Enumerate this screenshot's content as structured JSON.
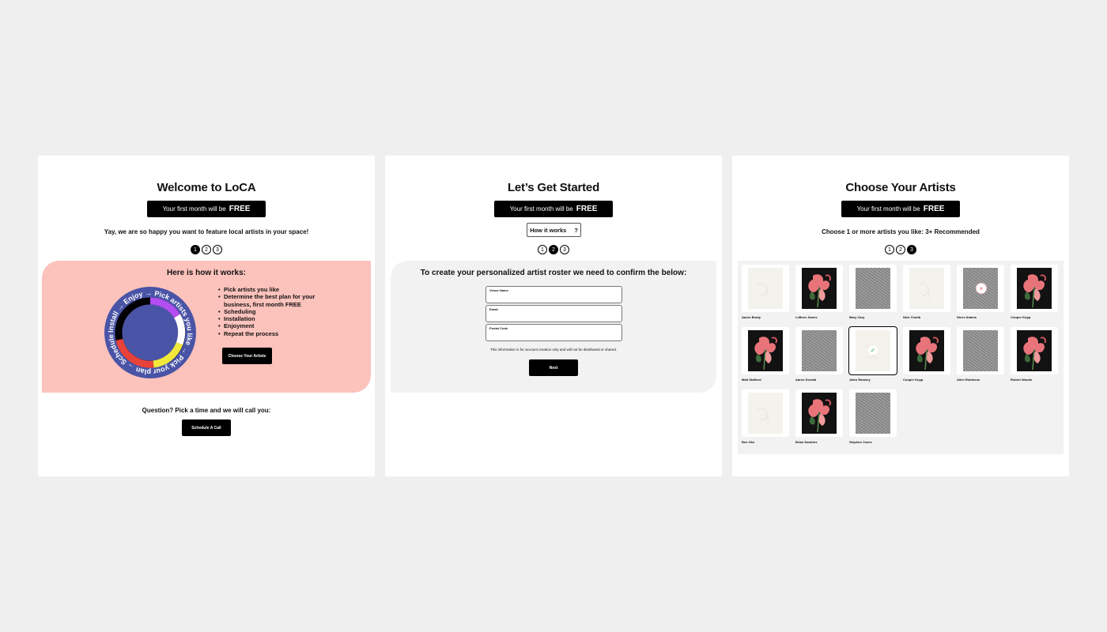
{
  "panels": {
    "welcome": {
      "title": "Welcome to LoCA",
      "badge_text": "Your first month will be",
      "badge_strong": "FREE",
      "subtitle": "Yay, we are so happy you want to feature local artists in your space!",
      "steps": [
        "1",
        "2",
        "3"
      ],
      "active_step": 1,
      "how_title": "Here is how it works:",
      "dial_labels": [
        "Pick artists you like →",
        "Pick your plan →",
        "Schedule →",
        "Install →",
        "Enjoy →"
      ],
      "how_items": [
        "Pick artists you like",
        "Determine the best plan for your business, first month FREE",
        "Scheduling",
        "Installation",
        "Enjoyment",
        "Repeat the process"
      ],
      "choose_button": "Choose Your Artists",
      "question": "Question? Pick a time and we will call you:",
      "schedule_button": "Schedule A Call"
    },
    "started": {
      "title": "Let’s Get Started",
      "badge_text": "Your first month will be",
      "badge_strong": "FREE",
      "how_button": "How it works",
      "how_icon": "?",
      "steps": [
        "1",
        "2",
        "3"
      ],
      "active_step": 2,
      "form_title": "To create your personalized artist roster we need to confirm the below:",
      "fields": [
        {
          "label": "Venue Name",
          "value": ""
        },
        {
          "label": "Email",
          "value": ""
        },
        {
          "label": "Postal Code",
          "value": ""
        }
      ],
      "note": "This information is for account creation only and will not be distributed or shared.",
      "next_button": "Next"
    },
    "artists": {
      "title": "Choose Your Artists",
      "badge_text": "Your first month will be",
      "badge_strong": "FREE",
      "subtitle": "Choose 1 or more artists you like: 3+ Recommended",
      "steps": [
        "1",
        "2",
        "3"
      ],
      "active_step": 3,
      "cards": [
        {
          "name": "Aaron Brady",
          "art": "plain",
          "state": "none"
        },
        {
          "name": "LeBron James",
          "art": "flower",
          "state": "none"
        },
        {
          "name": "Mary Cary",
          "art": "texture",
          "state": "none"
        },
        {
          "name": "Nick Chubb",
          "art": "plain",
          "state": "none"
        },
        {
          "name": "Steve Adams",
          "art": "texture",
          "state": "remove"
        },
        {
          "name": "Cooper Kupp",
          "art": "flower",
          "state": "none"
        },
        {
          "name": "Matt Stafford",
          "art": "flower",
          "state": "none"
        },
        {
          "name": "Aaron Donald",
          "art": "texture",
          "state": "none"
        },
        {
          "name": "Jalen Ramsey",
          "art": "plain",
          "state": "selected"
        },
        {
          "name": "Cooper Kupp",
          "art": "flower",
          "state": "none"
        },
        {
          "name": "Allen Robinson",
          "art": "texture",
          "state": "none"
        },
        {
          "name": "Robert Woods",
          "art": "flower",
          "state": "none"
        },
        {
          "name": "Ben Gks",
          "art": "plain",
          "state": "none"
        },
        {
          "name": "Brian Dawkins",
          "art": "flower",
          "state": "none"
        },
        {
          "name": "Stephon Jones",
          "art": "texture",
          "state": "none"
        }
      ]
    }
  },
  "colors": {
    "pink_panel": "#fcc2bc",
    "dial_blue": "#4a54a6",
    "dial_purple": "#b44df0",
    "dial_red": "#e8423a",
    "dial_yellow": "#f2e83c",
    "check_green": "#22a94a",
    "remove_red": "#f04c4c"
  }
}
